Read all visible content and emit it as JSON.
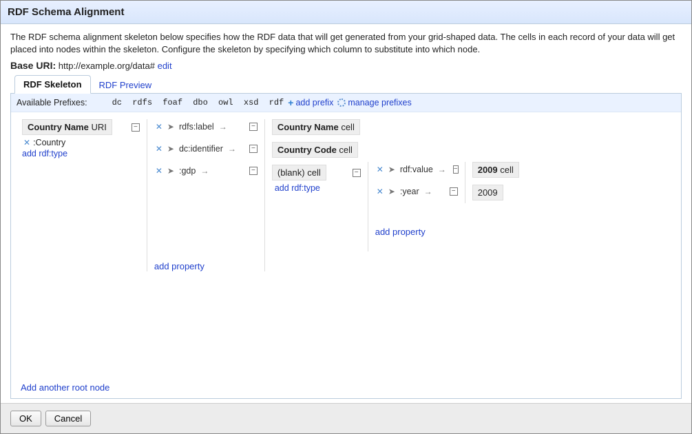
{
  "title": "RDF Schema Alignment",
  "description": "The RDF schema alignment skeleton below specifies how the RDF data that will get generated from your grid-shaped data. The cells in each record of your data will get placed into nodes within the skeleton. Configure the skeleton by specifying which column to substitute into which node.",
  "base_uri_label": "Base URI:",
  "base_uri_value": "http://example.org/data#",
  "base_uri_edit": "edit",
  "tabs": {
    "skeleton": "RDF Skeleton",
    "preview": "RDF Preview"
  },
  "prefixes": {
    "label": "Available Prefixes:",
    "list": "dc rdfs foaf dbo owl xsd rdf",
    "add": "add prefix",
    "manage": "manage prefixes"
  },
  "nodes": {
    "root": {
      "bold": "Country Name",
      "rest": " URI"
    },
    "root_type": ":Country",
    "add_type": "add rdf:type",
    "props": {
      "p1": "rdfs:label",
      "p2": "dc:identifier",
      "p3": ":gdp",
      "p4": "rdf:value",
      "p5": ":year"
    },
    "targets": {
      "t1": {
        "bold": "Country Name",
        "rest": " cell"
      },
      "t2": {
        "bold": "Country Code",
        "rest": " cell"
      },
      "t3": {
        "bold": "",
        "rest": "(blank) cell"
      },
      "t4": {
        "bold": "2009",
        "rest": " cell"
      },
      "t5": {
        "bold": "",
        "rest": "2009"
      }
    },
    "add_property": "add property"
  },
  "add_root": "Add another root node",
  "buttons": {
    "ok": "OK",
    "cancel": "Cancel"
  }
}
